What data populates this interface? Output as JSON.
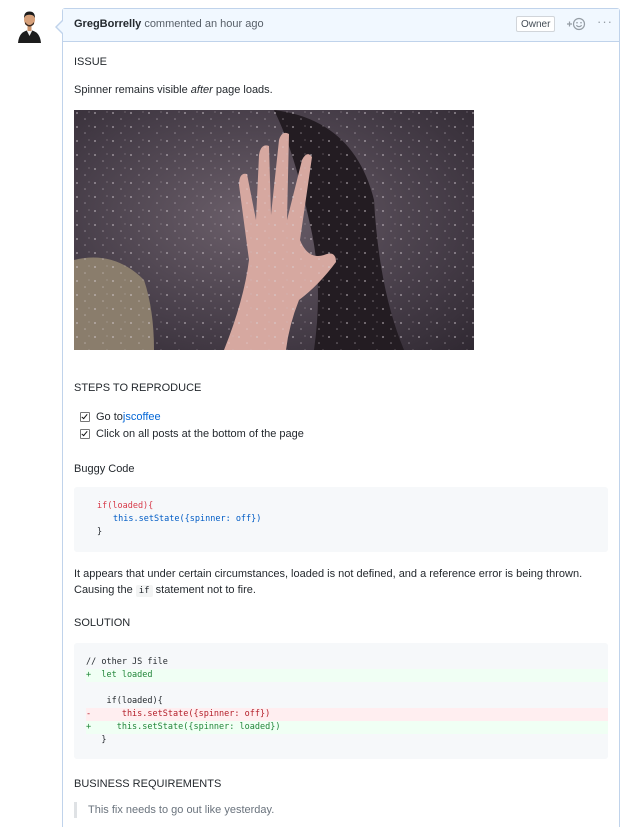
{
  "comment": {
    "author": "GregBorrelly",
    "action": "commented an hour ago",
    "badge": "Owner",
    "react_symbol": "+☺",
    "more_symbol": "···"
  },
  "issue": {
    "heading": "ISSUE",
    "text_before": "Spinner remains visible ",
    "text_em": "after",
    "text_after": " page loads."
  },
  "steps": {
    "heading": "STEPS TO REPRODUCE",
    "items": [
      {
        "prefix": "Go to ",
        "link": "jscoffee",
        "checked": true
      },
      {
        "text": "Click on all posts at the bottom of the page",
        "checked": true
      }
    ]
  },
  "buggy": {
    "heading": "Buggy Code",
    "lines": [
      "if(loaded){",
      "this.setState({spinner: off})",
      "}"
    ]
  },
  "explanation": {
    "line1": "It appears that under certain circumstances, loaded is not defined, and a reference error is being thrown.",
    "line2_before": "Causing the ",
    "line2_code": "if",
    "line2_after": " statement not to fire."
  },
  "solution": {
    "heading": "SOLUTION",
    "lines": [
      "// other JS file",
      "+  let loaded",
      "",
      "    if(loaded){",
      "-      this.setState({spinner: off})",
      "+     this.setState({spinner: loaded})",
      "   }"
    ]
  },
  "business": {
    "heading": "BUSINESS REQUIREMENTS",
    "quote": "This fix needs to go out like yesterday."
  },
  "colors": {
    "header_bg": "#f1f8ff",
    "border": "#c0d3eb",
    "link": "#0366d6",
    "diff_del": "#b31d28",
    "diff_add": "#22863a"
  }
}
